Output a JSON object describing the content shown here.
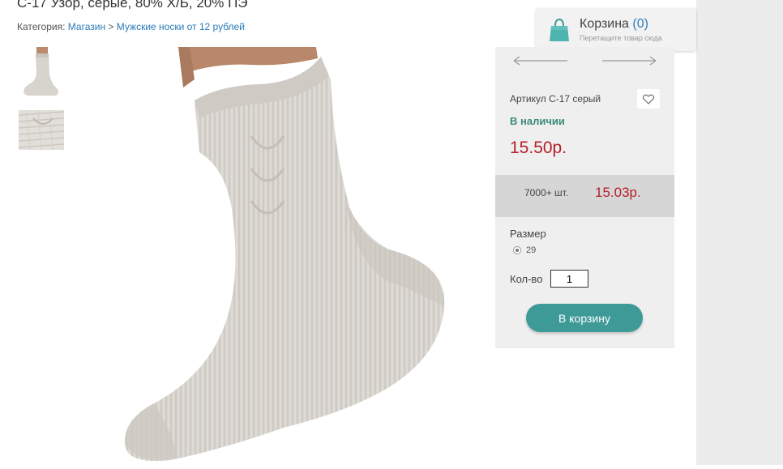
{
  "product": {
    "title": "С-17 Узор, серые, 80% Х/Б, 20% ПЭ",
    "breadcrumb": {
      "prefix": "Категория:",
      "links": [
        "Магазин",
        "Мужские носки от 12 рублей"
      ],
      "separator": ">"
    },
    "sku": "Артикул С-17 серый",
    "availability": "В наличии",
    "price": "15.50р.",
    "wholesale": {
      "quantity": "7000+ шт.",
      "price": "15.03р."
    },
    "size": {
      "label": "Размер",
      "options": [
        "29"
      ]
    },
    "quantity": {
      "label": "Кол-во",
      "value": "1"
    },
    "buy_button_label": "В корзину"
  },
  "cart": {
    "title": "Корзина",
    "count": "(0)",
    "subtitle": "Перетащите товар сюда"
  },
  "colors": {
    "accent": "#3d9a96",
    "price": "#b5202a",
    "in_stock": "#3c8a7c",
    "link": "#2a7ab8"
  },
  "icons": [
    "shopping-bag-icon",
    "arrow-left-icon",
    "arrow-right-icon",
    "heart-icon"
  ]
}
